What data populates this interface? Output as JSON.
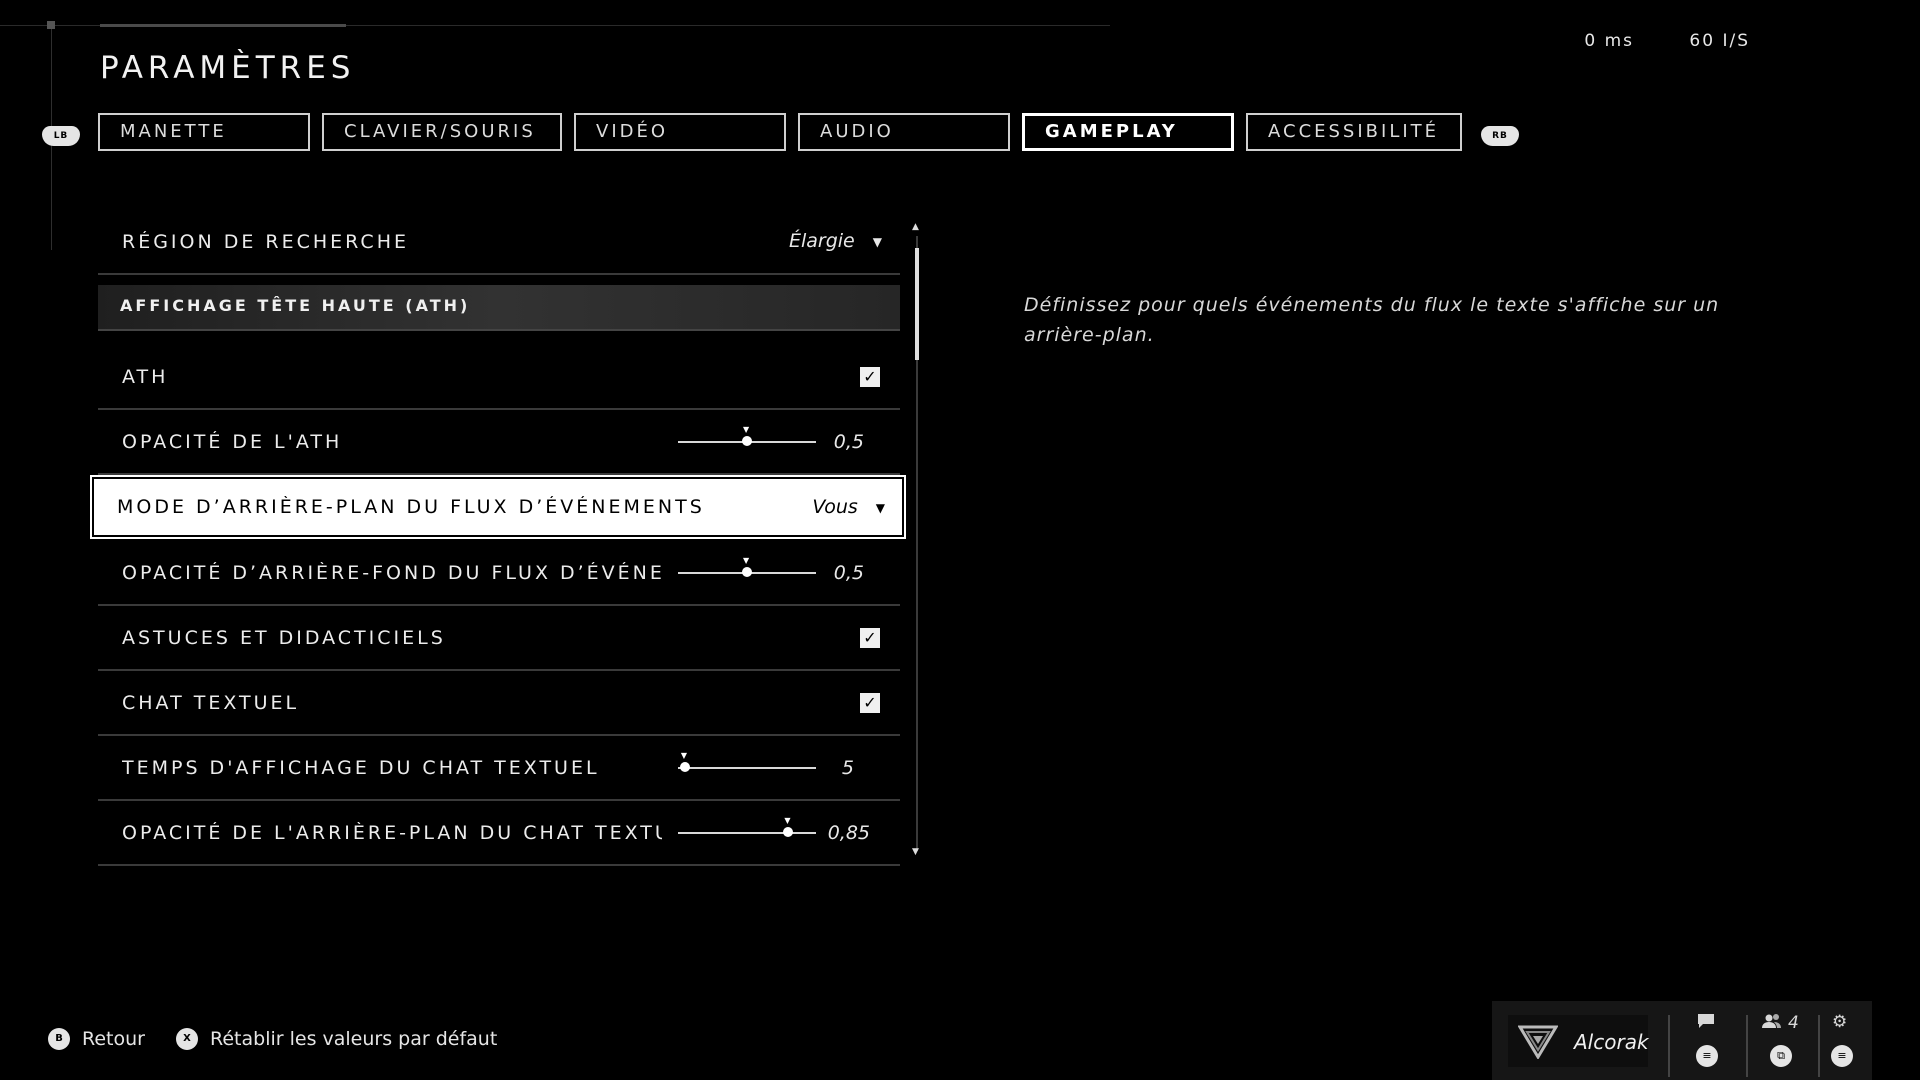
{
  "header": {
    "title": "PARAMÈTRES",
    "stats": {
      "latency": "0 ms",
      "fps": "60 I/S"
    },
    "bumper_left": "LB",
    "bumper_right": "RB"
  },
  "tabs": [
    {
      "label": "MANETTE",
      "active": false
    },
    {
      "label": "CLAVIER/SOURIS",
      "active": false
    },
    {
      "label": "VIDÉO",
      "active": false
    },
    {
      "label": "AUDIO",
      "active": false
    },
    {
      "label": "GAMEPLAY",
      "active": true
    },
    {
      "label": "ACCESSIBILITÉ",
      "active": false
    }
  ],
  "settings": {
    "search_region": {
      "label": "RÉGION DE RECHERCHE",
      "value": "Élargie"
    },
    "section_hud": {
      "label": "AFFICHAGE TÊTE HAUTE (ATH)"
    },
    "hud": {
      "label": "ATH",
      "checked": true
    },
    "hud_opacity": {
      "label": "OPACITÉ DE L'ATH",
      "value": "0,5",
      "fraction": 0.5
    },
    "event_feed_bg_mode": {
      "label": "MODE D’ARRIÈRE-PLAN DU FLUX D’ÉVÉNEMENTS",
      "value": "Vous"
    },
    "event_feed_bg_opacity": {
      "label": "OPACITÉ D’ARRIÈRE-FOND DU FLUX D’ÉVÉNEM",
      "value": "0,5",
      "fraction": 0.5
    },
    "tips": {
      "label": "ASTUCES ET DIDACTICIELS",
      "checked": true
    },
    "text_chat": {
      "label": "CHAT TEXTUEL",
      "checked": true
    },
    "text_chat_duration": {
      "label": "TEMPS D'AFFICHAGE DU CHAT TEXTUEL",
      "value": "5",
      "fraction": 0.05
    },
    "text_chat_bg_opacity": {
      "label": "OPACITÉ DE L'ARRIÈRE-PLAN DU CHAT TEXTU",
      "value": "0,85",
      "fraction": 0.8
    }
  },
  "description": "Définissez pour quels événements du flux le texte s'affiche sur un arrière-plan.",
  "footer": {
    "back": {
      "button": "B",
      "label": "Retour"
    },
    "reset": {
      "button": "X",
      "label": "Rétablir les valeurs par défaut"
    }
  },
  "dock": {
    "username": "Alcorak",
    "friends_count": "4"
  },
  "icons": {
    "dropdown": "▼",
    "check": "✓",
    "scroll_up": "▲",
    "scroll_down": "▼"
  }
}
